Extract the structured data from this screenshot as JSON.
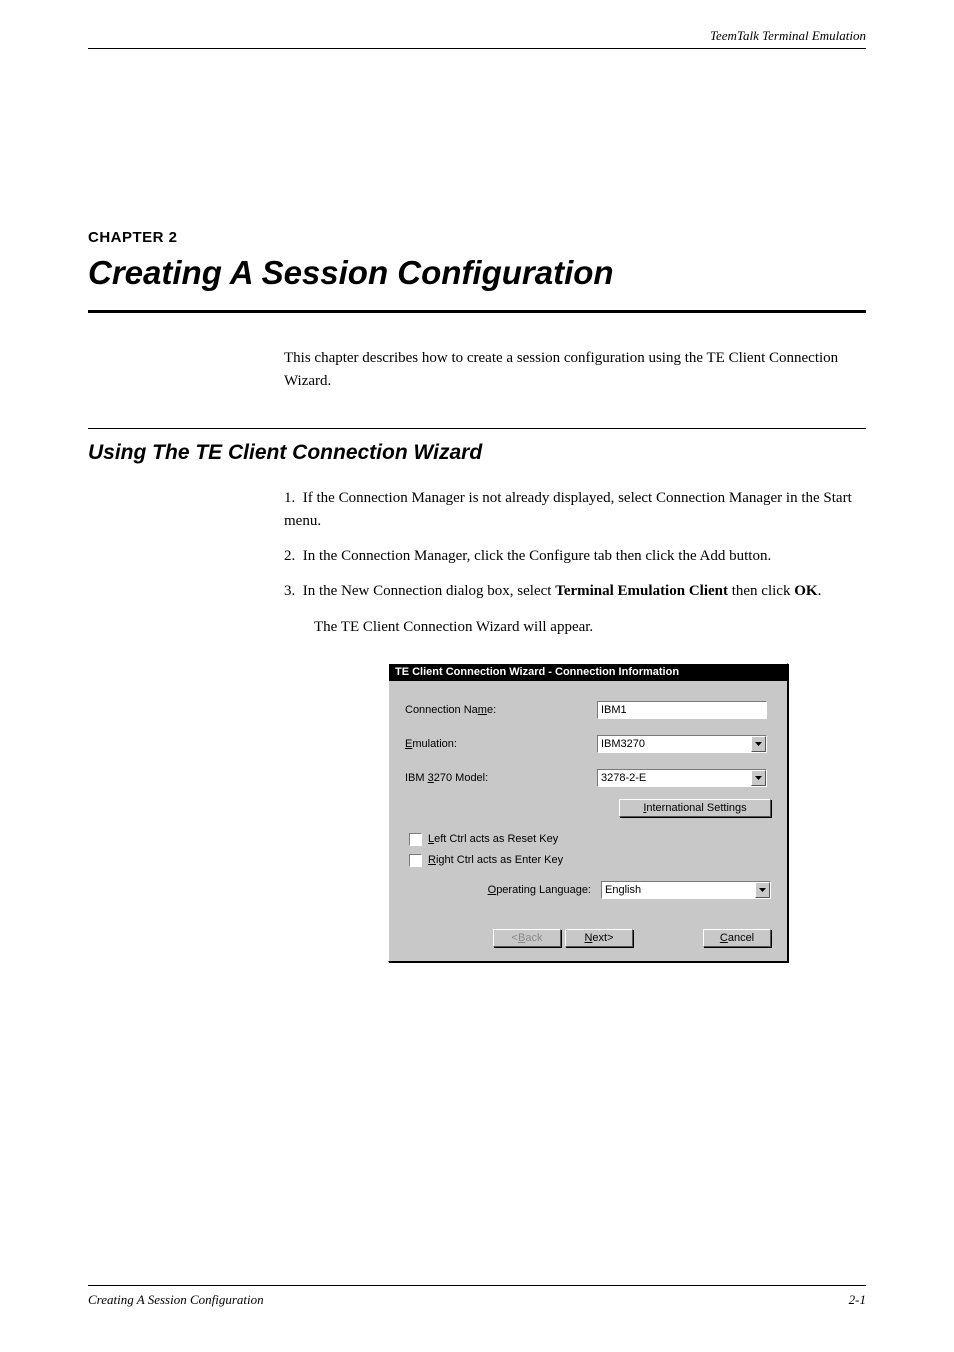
{
  "header_right": "TeemTalk Terminal Emulation",
  "chapter_num": "CHAPTER 2",
  "chapter_title": "Creating A Session Configuration",
  "intro": "This chapter describes how to create a session configuration using the TE Client Connection Wizard.",
  "section_title": "Using The TE Client Connection Wizard",
  "steps": {
    "s1_prefix": "1.",
    "s1": "If the Connection Manager is not already displayed, select Connection Manager in the Start menu.",
    "s2_prefix": "2.",
    "s2": "In the Connection Manager, click the Configure tab then click the Add button.",
    "s3_prefix": "3.",
    "s3_a": "In the New Connection dialog box, select ",
    "s3_b": "Terminal Emulation Client",
    "s3_c": " then click ",
    "s3_d": "OK",
    "s3_e": ".",
    "sub": "The TE Client Connection Wizard will appear."
  },
  "dialog": {
    "title": "TE Client Connection Wizard - Connection Information",
    "labels": {
      "conn_name": "Connection Name:",
      "emulation": "Emulation:",
      "model": "IBM 3270 Model:",
      "intl": "International Settings",
      "left_ctrl": "Left Ctrl acts as Reset Key",
      "right_ctrl": "Right Ctrl acts as Enter Key",
      "op_lang": "Operating Language:"
    },
    "values": {
      "conn_name": "IBM1",
      "emulation": "IBM3270",
      "model": "3278-2-E",
      "op_lang": "English"
    },
    "buttons": {
      "back": "Back",
      "next": "Next>",
      "cancel": "Cancel"
    },
    "mn": {
      "conn_name_u": "m",
      "emulation_u": "E",
      "model_u": "3",
      "intl_u": "I",
      "left_u": "L",
      "right_u": "R",
      "op_u": "O",
      "back_u": "B",
      "next_u": "N",
      "cancel_u": "C"
    }
  },
  "footer": {
    "left": "Creating A Session Configuration",
    "right": "2-1"
  }
}
